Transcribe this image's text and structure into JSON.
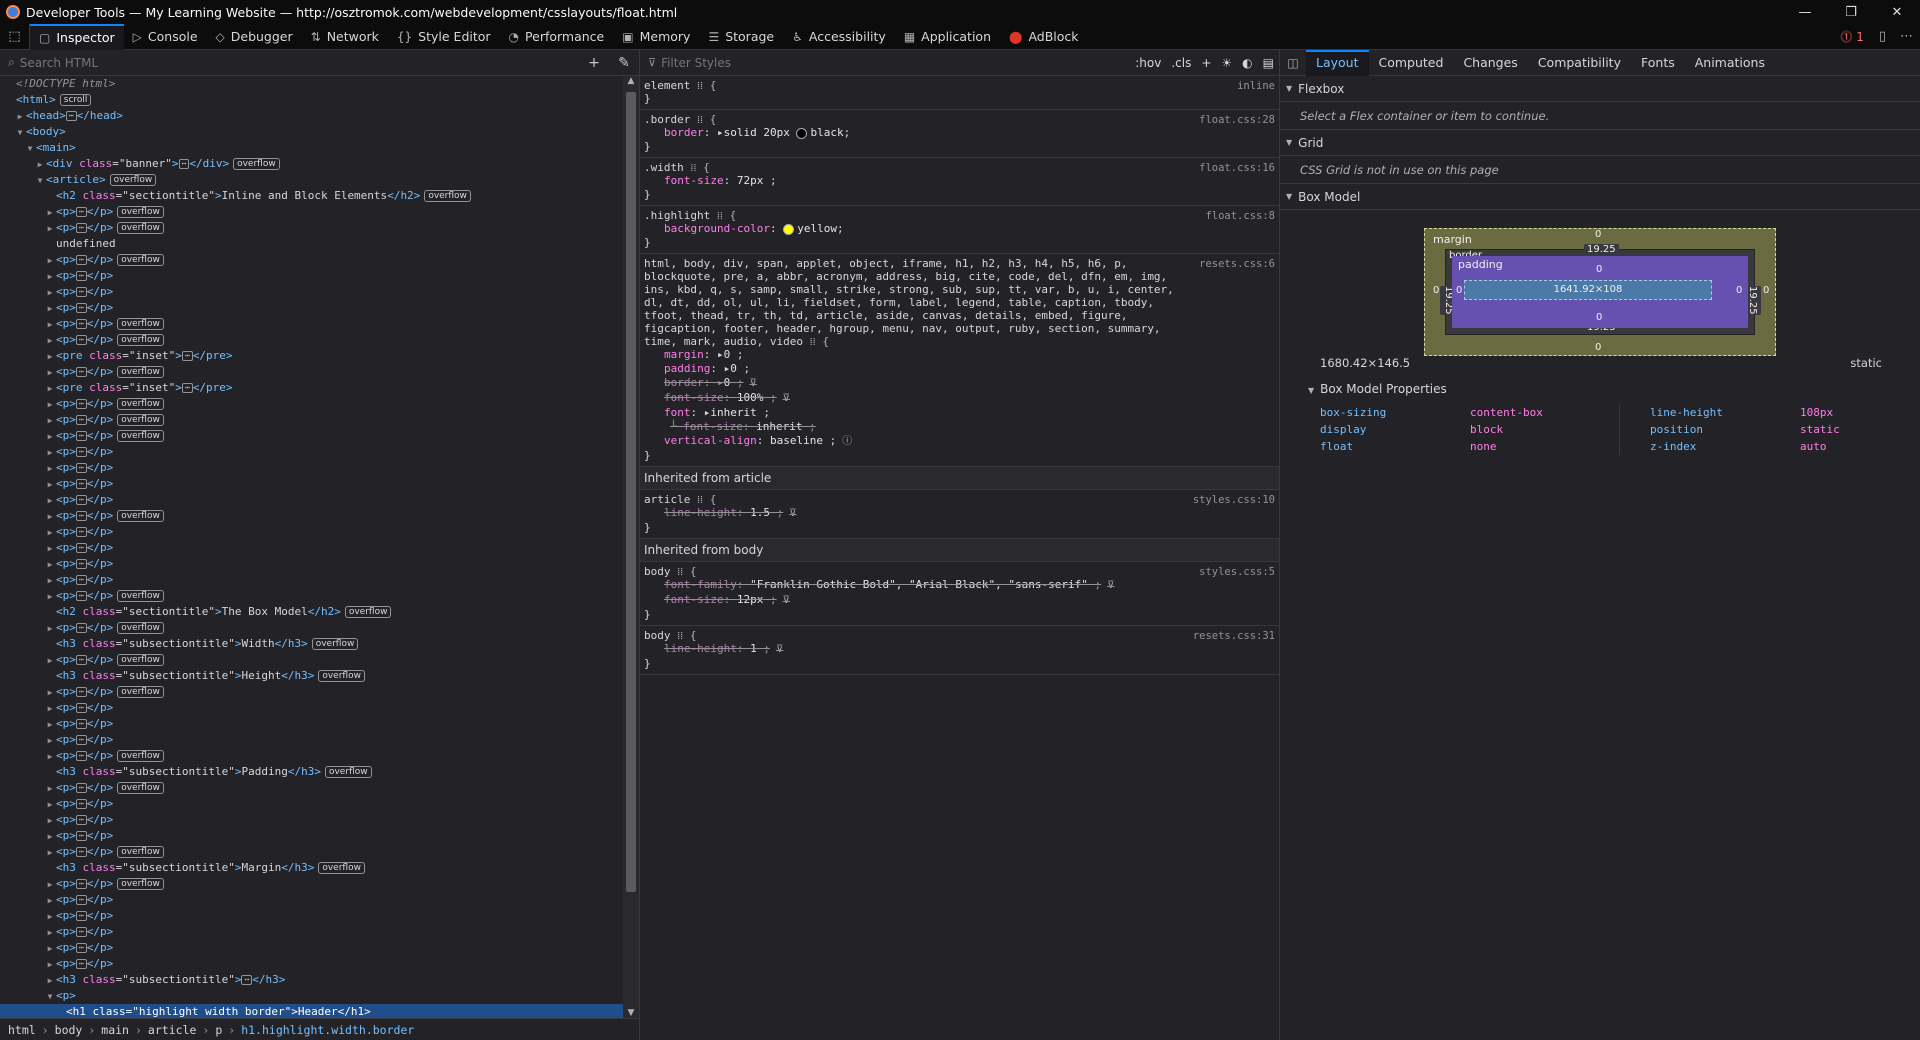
{
  "titlebar": {
    "title": "Developer Tools — My Learning Website — http://osztromok.com/webdevelopment/csslayouts/float.html",
    "min": "—",
    "restore": "❐",
    "close": "✕"
  },
  "toolbar": {
    "tools": [
      {
        "label": "Inspector",
        "icon": "▢",
        "name": "inspector-icon"
      },
      {
        "label": "Console",
        "icon": "▷",
        "name": "console-icon"
      },
      {
        "label": "Debugger",
        "icon": "◇",
        "name": "debugger-icon"
      },
      {
        "label": "Network",
        "icon": "⇅",
        "name": "network-icon"
      },
      {
        "label": "Style Editor",
        "icon": "{}",
        "name": "style-editor-icon"
      },
      {
        "label": "Performance",
        "icon": "◔",
        "name": "performance-icon"
      },
      {
        "label": "Memory",
        "icon": "▣",
        "name": "memory-icon"
      },
      {
        "label": "Storage",
        "icon": "☰",
        "name": "storage-icon"
      },
      {
        "label": "Accessibility",
        "icon": "♿",
        "name": "accessibility-icon"
      },
      {
        "label": "Application",
        "icon": "▦",
        "name": "application-icon"
      },
      {
        "label": "AdBlock",
        "icon": "⬤",
        "name": "adblock-icon"
      }
    ],
    "error_count": "1"
  },
  "inspector": {
    "search_placeholder": "Search HTML"
  },
  "tree": [
    {
      "d": 0,
      "k": "comment",
      "t": "<!DOCTYPE html>"
    },
    {
      "d": 0,
      "k": "open",
      "tag": "html",
      "badge": "scroll"
    },
    {
      "d": 1,
      "k": "collapsed",
      "tag": "head"
    },
    {
      "d": 1,
      "k": "exp",
      "tag": "body"
    },
    {
      "d": 2,
      "k": "exp",
      "tag": "main"
    },
    {
      "d": 3,
      "k": "collapsed",
      "tag": "div",
      "attrs": [
        [
          "class",
          "banner"
        ]
      ],
      "badge": "overflow"
    },
    {
      "d": 3,
      "k": "exp",
      "tag": "article",
      "badge": "overflow"
    },
    {
      "d": 4,
      "k": "leaf",
      "tag": "h2",
      "attrs": [
        [
          "class",
          "sectiontitle"
        ]
      ],
      "text": "Inline and Block Elements",
      "badge": "overflow"
    },
    {
      "d": 4,
      "k": "collapsed",
      "tag": "p",
      "badge": "overflow"
    },
    {
      "d": 4,
      "k": "collapsed",
      "tag": "p",
      "badge": "overflow"
    },
    {
      "d": 4,
      "k": "text",
      "t": "undefined"
    },
    {
      "d": 4,
      "k": "collapsed",
      "tag": "p",
      "badge": "overflow"
    },
    {
      "d": 4,
      "k": "collapsed",
      "tag": "p"
    },
    {
      "d": 4,
      "k": "collapsed",
      "tag": "p"
    },
    {
      "d": 4,
      "k": "collapsed",
      "tag": "p"
    },
    {
      "d": 4,
      "k": "collapsed",
      "tag": "p",
      "badge": "overflow"
    },
    {
      "d": 4,
      "k": "collapsed",
      "tag": "p",
      "badge": "overflow"
    },
    {
      "d": 4,
      "k": "collapsed",
      "tag": "pre",
      "attrs": [
        [
          "class",
          "inset"
        ]
      ]
    },
    {
      "d": 4,
      "k": "collapsed",
      "tag": "p",
      "badge": "overflow"
    },
    {
      "d": 4,
      "k": "collapsed",
      "tag": "pre",
      "attrs": [
        [
          "class",
          "inset"
        ]
      ]
    },
    {
      "d": 4,
      "k": "collapsed",
      "tag": "p",
      "badge": "overflow"
    },
    {
      "d": 4,
      "k": "collapsed",
      "tag": "p",
      "badge": "overflow"
    },
    {
      "d": 4,
      "k": "collapsed",
      "tag": "p",
      "badge": "overflow"
    },
    {
      "d": 4,
      "k": "collapsed",
      "tag": "p"
    },
    {
      "d": 4,
      "k": "collapsed",
      "tag": "p"
    },
    {
      "d": 4,
      "k": "collapsed",
      "tag": "p"
    },
    {
      "d": 4,
      "k": "collapsed",
      "tag": "p"
    },
    {
      "d": 4,
      "k": "collapsed",
      "tag": "p",
      "badge": "overflow"
    },
    {
      "d": 4,
      "k": "collapsed",
      "tag": "p"
    },
    {
      "d": 4,
      "k": "collapsed",
      "tag": "p"
    },
    {
      "d": 4,
      "k": "collapsed",
      "tag": "p"
    },
    {
      "d": 4,
      "k": "collapsed",
      "tag": "p"
    },
    {
      "d": 4,
      "k": "collapsed",
      "tag": "p",
      "badge": "overflow"
    },
    {
      "d": 4,
      "k": "leaf",
      "tag": "h2",
      "attrs": [
        [
          "class",
          "sectiontitle"
        ]
      ],
      "text": "The Box Model",
      "badge": "overflow"
    },
    {
      "d": 4,
      "k": "collapsed",
      "tag": "p",
      "badge": "overflow"
    },
    {
      "d": 4,
      "k": "leaf",
      "tag": "h3",
      "attrs": [
        [
          "class",
          "subsectiontitle"
        ]
      ],
      "text": "Width",
      "badge": "overflow"
    },
    {
      "d": 4,
      "k": "collapsed",
      "tag": "p",
      "badge": "overflow"
    },
    {
      "d": 4,
      "k": "leaf",
      "tag": "h3",
      "attrs": [
        [
          "class",
          "subsectiontitle"
        ]
      ],
      "text": "Height",
      "badge": "overflow"
    },
    {
      "d": 4,
      "k": "collapsed",
      "tag": "p",
      "badge": "overflow"
    },
    {
      "d": 4,
      "k": "collapsed",
      "tag": "p"
    },
    {
      "d": 4,
      "k": "collapsed",
      "tag": "p"
    },
    {
      "d": 4,
      "k": "collapsed",
      "tag": "p"
    },
    {
      "d": 4,
      "k": "collapsed",
      "tag": "p",
      "badge": "overflow"
    },
    {
      "d": 4,
      "k": "leaf",
      "tag": "h3",
      "attrs": [
        [
          "class",
          "subsectiontitle"
        ]
      ],
      "text": "Padding",
      "badge": "overflow"
    },
    {
      "d": 4,
      "k": "collapsed",
      "tag": "p",
      "badge": "overflow"
    },
    {
      "d": 4,
      "k": "collapsed",
      "tag": "p"
    },
    {
      "d": 4,
      "k": "collapsed",
      "tag": "p"
    },
    {
      "d": 4,
      "k": "collapsed",
      "tag": "p"
    },
    {
      "d": 4,
      "k": "collapsed",
      "tag": "p",
      "badge": "overflow"
    },
    {
      "d": 4,
      "k": "leaf",
      "tag": "h3",
      "attrs": [
        [
          "class",
          "subsectiontitle"
        ]
      ],
      "text": "Margin",
      "badge": "overflow"
    },
    {
      "d": 4,
      "k": "collapsed",
      "tag": "p",
      "badge": "overflow"
    },
    {
      "d": 4,
      "k": "collapsed",
      "tag": "p"
    },
    {
      "d": 4,
      "k": "collapsed",
      "tag": "p"
    },
    {
      "d": 4,
      "k": "collapsed",
      "tag": "p"
    },
    {
      "d": 4,
      "k": "collapsed",
      "tag": "p"
    },
    {
      "d": 4,
      "k": "collapsed",
      "tag": "p"
    },
    {
      "d": 4,
      "k": "collapsed",
      "tag": "h3",
      "attrs": [
        [
          "class",
          "subsectiontitle"
        ]
      ]
    },
    {
      "d": 4,
      "k": "exp",
      "tag": "p"
    },
    {
      "d": 5,
      "k": "leaf",
      "tag": "h1",
      "attrs": [
        [
          "class",
          "highlight width border"
        ]
      ],
      "text": "Header",
      "sel": true
    }
  ],
  "breadcrumb": [
    "html",
    "body",
    "main",
    "article",
    "p",
    "h1.highlight.width.border"
  ],
  "rules_panel": {
    "filter_placeholder": "Filter Styles",
    "hov": ":hov",
    "cls": ".cls"
  },
  "rules": [
    {
      "selector": "element",
      "source": "inline",
      "decls": []
    },
    {
      "selector": ".border",
      "source": "float.css:28",
      "decls": [
        {
          "p": "border",
          "v": "solid 20px",
          "color": "#000000",
          "v2": "black"
        }
      ]
    },
    {
      "selector": ".width",
      "source": "float.css:16",
      "decls": [
        {
          "p": "font-size",
          "v": "72px"
        }
      ]
    },
    {
      "selector": ".highlight",
      "source": "float.css:8",
      "decls": [
        {
          "p": "background-color",
          "color": "#ffff00",
          "v2": "yellow"
        }
      ]
    },
    {
      "selector": "html, body, div, span, applet, object, iframe, h1, h2, h3, h4, h5, h6, p, blockquote, pre, a, abbr, acronym, address, big, cite, code, del, dfn, em, img, ins, kbd, q, s, samp, small, strike, strong, sub, sup, tt, var, b, u, i, center, dl, dt, dd, ol, ul, li, fieldset, form, label, legend, table, caption, tbody, tfoot, thead, tr, th, td, article, aside, canvas, details, embed, figure, figcaption, footer, header, hgroup, menu, nav, output, ruby, section, summary, time, mark, audio, video",
      "source": "resets.css:6",
      "decls": [
        {
          "p": "margin",
          "v": "0"
        },
        {
          "p": "padding",
          "v": "0"
        },
        {
          "p": "border",
          "v": "0",
          "strike": true,
          "filter": true
        },
        {
          "p": "font-size",
          "v": "100%",
          "strike": true,
          "filter": true
        },
        {
          "p": "font",
          "v": "inherit"
        },
        {
          "p": "font-size",
          "v": "inherit",
          "strike": true,
          "sub": true
        },
        {
          "p": "vertical-align",
          "v": "baseline",
          "info": true
        }
      ]
    },
    {
      "inherited": "Inherited from article"
    },
    {
      "selector": "article",
      "source": "styles.css:10",
      "decls": [
        {
          "p": "line-height",
          "v": "1.5",
          "strike": true,
          "filter": true
        }
      ]
    },
    {
      "inherited": "Inherited from body"
    },
    {
      "selector": "body",
      "source": "styles.css:5",
      "decls": [
        {
          "p": "font-family",
          "v": "\"Franklin Gothic Bold\", \"Arial Black\", \"sans-serif\"",
          "strike": true,
          "filter": true
        },
        {
          "p": "font-size",
          "v": "12px",
          "strike": true,
          "filter": true
        }
      ]
    },
    {
      "selector": "body",
      "source": "resets.css:31",
      "decls": [
        {
          "p": "line-height",
          "v": "1",
          "strike": true,
          "filter": true
        }
      ]
    }
  ],
  "layout": {
    "tabs": [
      "Layout",
      "Computed",
      "Changes",
      "Compatibility",
      "Fonts",
      "Animations"
    ],
    "flexbox_title": "Flexbox",
    "flexbox_msg": "Select a Flex container or item to continue.",
    "grid_title": "Grid",
    "grid_msg": "CSS Grid is not in use on this page",
    "boxmodel_title": "Box Model",
    "bm": {
      "margin_label": "margin",
      "border_label": "border",
      "padding_label": "padding",
      "content": "1641.92×108",
      "margin": [
        "0",
        "0",
        "0",
        "0"
      ],
      "border": [
        "19.25",
        "19.25",
        "19.25",
        "19.25"
      ],
      "padding": [
        "0",
        "0",
        "0",
        "0"
      ]
    },
    "size": "1680.42×146.5",
    "position": "static",
    "props_title": "Box Model Properties",
    "props_left": [
      [
        "box-sizing",
        "content-box"
      ],
      [
        "display",
        "block"
      ],
      [
        "float",
        "none"
      ]
    ],
    "props_right": [
      [
        "line-height",
        "108px"
      ],
      [
        "position",
        "static"
      ],
      [
        "z-index",
        "auto"
      ]
    ]
  }
}
